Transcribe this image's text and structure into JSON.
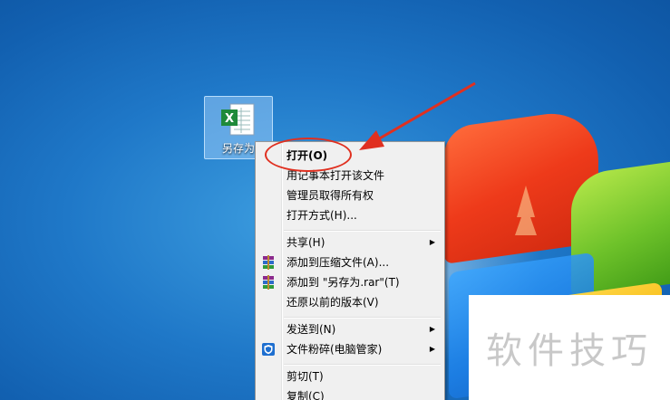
{
  "desktop": {
    "file_label": "另存为",
    "watermark": "软件技巧"
  },
  "menu": {
    "items": [
      {
        "label": "打开(O)"
      },
      {
        "label": "用记事本打开该文件"
      },
      {
        "label": "管理员取得所有权"
      },
      {
        "label": "打开方式(H)..."
      },
      {
        "label": "共享(H)"
      },
      {
        "label": "添加到压缩文件(A)..."
      },
      {
        "label": "添加到 \"另存为.rar\"(T)"
      },
      {
        "label": "还原以前的版本(V)"
      },
      {
        "label": "发送到(N)"
      },
      {
        "label": "文件粉碎(电脑管家)"
      },
      {
        "label": "剪切(T)"
      },
      {
        "label": "复制(C)"
      }
    ]
  },
  "colors": {
    "annotation": "#e03020",
    "menu_bg": "#f0f0f0"
  }
}
